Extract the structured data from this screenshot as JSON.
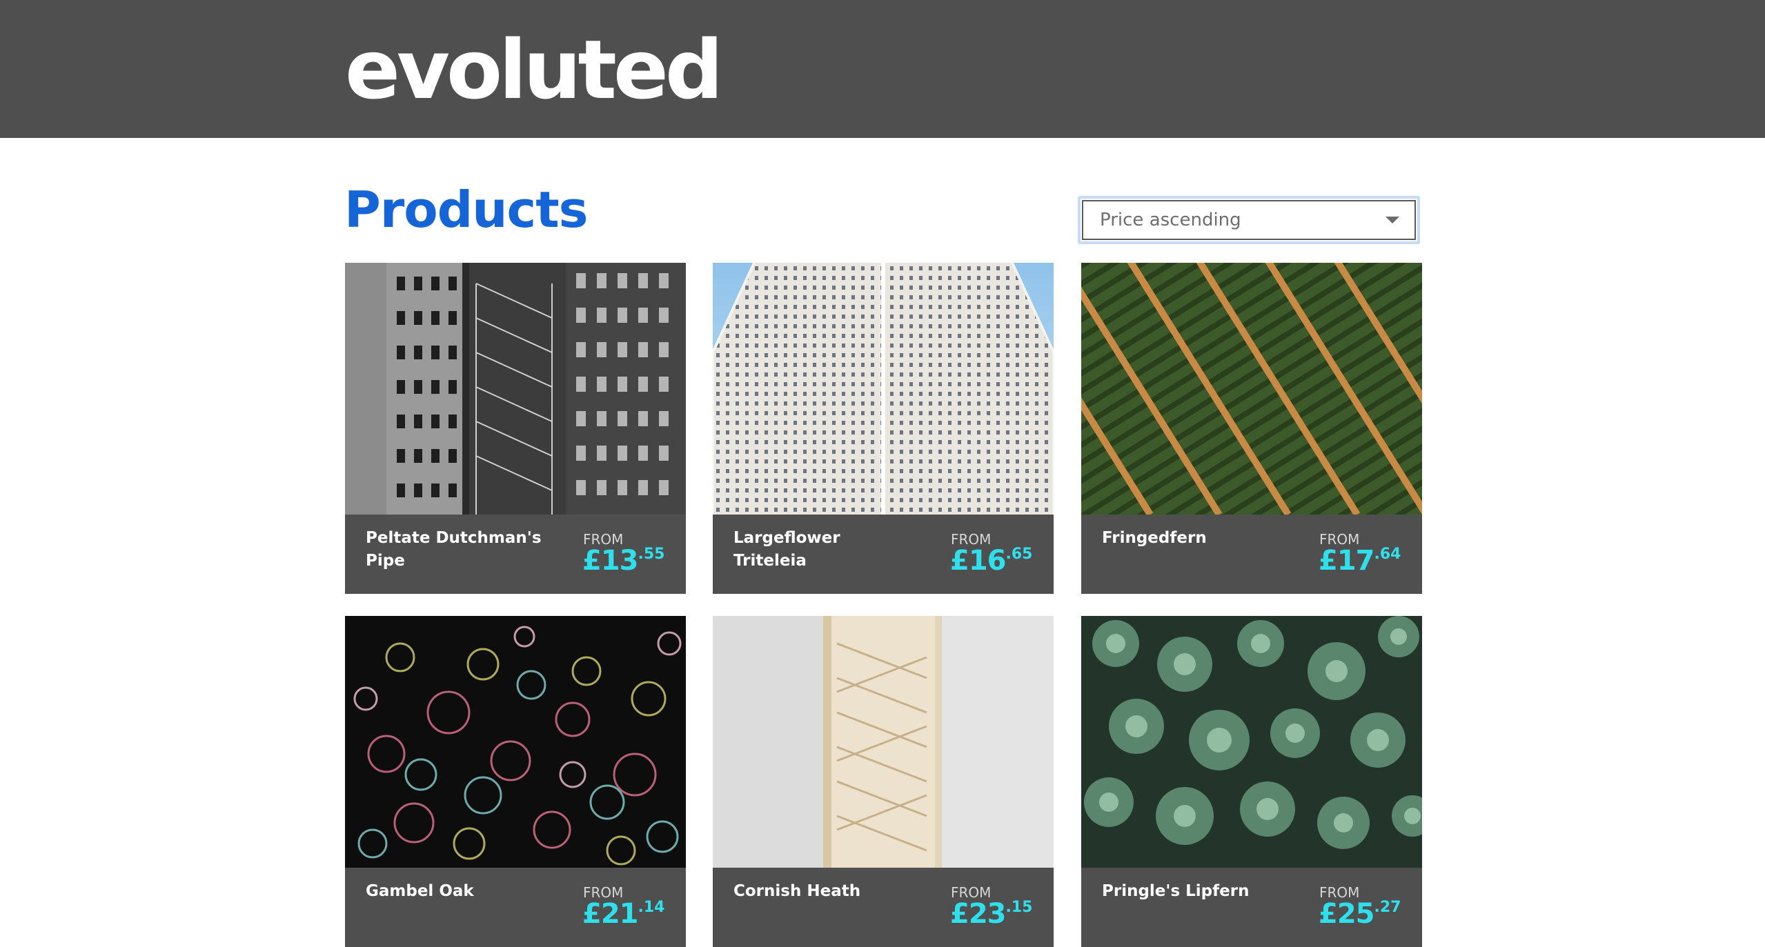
{
  "header": {
    "logo_text": "evoluted"
  },
  "main": {
    "title": "Products",
    "sort": {
      "selected": "Price ascending"
    }
  },
  "products": [
    {
      "name": "Peltate Dutchman's Pipe",
      "from_label": "FROM",
      "price_main": "£13",
      "price_dec": ".55",
      "image": "black-and-white-building-photo"
    },
    {
      "name": "Largeflower Triteleia",
      "from_label": "FROM",
      "price_main": "£16",
      "price_dec": ".65",
      "image": "skyscraper-facade-photo"
    },
    {
      "name": "Fringedfern",
      "from_label": "FROM",
      "price_main": "£17",
      "price_dec": ".64",
      "image": "aerial-field-rows-photo"
    },
    {
      "name": "Gambel Oak",
      "from_label": "FROM",
      "price_main": "£21",
      "price_dec": ".14",
      "image": "fireworks-photo"
    },
    {
      "name": "Cornish Heath",
      "from_label": "FROM",
      "price_main": "£23",
      "price_dec": ".15",
      "image": "stairwell-photo"
    },
    {
      "name": "Pringle's Lipfern",
      "from_label": "FROM",
      "price_main": "£25",
      "price_dec": ".27",
      "image": "succulents-photo"
    }
  ]
}
